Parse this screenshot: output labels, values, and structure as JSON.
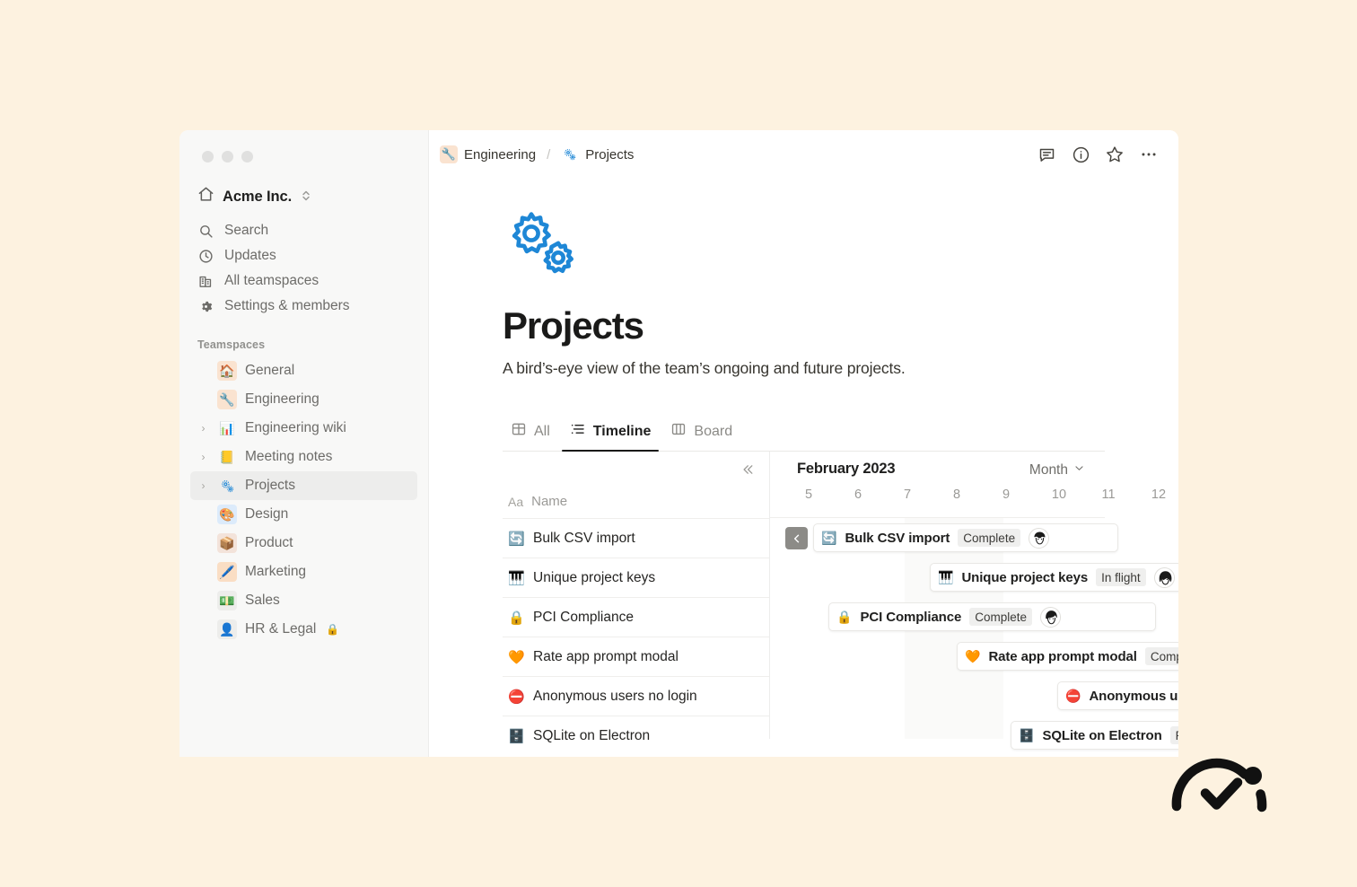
{
  "window": {
    "traffic_lights": [
      "close",
      "minimize",
      "zoom"
    ]
  },
  "sidebar": {
    "workspace": {
      "name": "Acme Inc.",
      "icon": "house-icon",
      "caret": "chevron-updown-icon"
    },
    "nav": [
      {
        "label": "Search",
        "icon": "search-icon"
      },
      {
        "label": "Updates",
        "icon": "clock-icon"
      },
      {
        "label": "All teamspaces",
        "icon": "buildings-icon"
      },
      {
        "label": "Settings & members",
        "icon": "gear-icon"
      }
    ],
    "section_label": "Teamspaces",
    "teamspaces": [
      {
        "label": "General",
        "emoji": "🏠",
        "bg": "#FAE3D0",
        "arrow": false,
        "active": false,
        "locked": false
      },
      {
        "label": "Engineering",
        "emoji": "🔧",
        "bg": "#FAE3D0",
        "arrow": false,
        "active": false,
        "locked": false
      },
      {
        "label": "Engineering wiki",
        "emoji": "📊",
        "bg": "transparent",
        "arrow": true,
        "active": false,
        "locked": false
      },
      {
        "label": "Meeting notes",
        "emoji": "📒",
        "bg": "transparent",
        "arrow": true,
        "active": false,
        "locked": false
      },
      {
        "label": "Projects",
        "emoji": "⚙️",
        "bg": "transparent",
        "arrow": true,
        "active": true,
        "locked": false
      },
      {
        "label": "Design",
        "emoji": "🎨",
        "bg": "#DCEBFB",
        "arrow": false,
        "active": false,
        "locked": false
      },
      {
        "label": "Product",
        "emoji": "📦",
        "bg": "#F3E3DA",
        "arrow": false,
        "active": false,
        "locked": false
      },
      {
        "label": "Marketing",
        "emoji": "🖊️",
        "bg": "#FADEC4",
        "arrow": false,
        "active": false,
        "locked": false
      },
      {
        "label": "Sales",
        "emoji": "💵",
        "bg": "#EDEDEB",
        "arrow": false,
        "active": false,
        "locked": false
      },
      {
        "label": "HR & Legal",
        "emoji": "👤",
        "bg": "#EDEDEB",
        "arrow": false,
        "active": false,
        "locked": true,
        "lock_emoji": "🔒"
      }
    ]
  },
  "topbar": {
    "breadcrumb": [
      {
        "label": "Engineering",
        "emoji": "🔧",
        "bg": "#FAE3D0"
      },
      {
        "label": "Projects",
        "emoji": "⚙️",
        "bg": "transparent"
      }
    ],
    "separator": "/",
    "actions": [
      {
        "name": "comments-icon"
      },
      {
        "name": "info-icon"
      },
      {
        "name": "star-icon"
      },
      {
        "name": "more-options-icon"
      }
    ]
  },
  "page": {
    "icon": "gears-icon",
    "title": "Projects",
    "description": "A bird’s-eye view of the team’s ongoing and future projects."
  },
  "view_tabs": [
    {
      "label": "All",
      "icon": "table-icon",
      "active": false
    },
    {
      "label": "Timeline",
      "icon": "timeline-icon",
      "active": true
    },
    {
      "label": "Board",
      "icon": "board-icon",
      "active": false
    }
  ],
  "timeline": {
    "collapse_icon": "chevrons-left-icon",
    "name_column": {
      "type_glyph": "Aa",
      "header": "Name"
    },
    "month_label": "February 2023",
    "scale": {
      "value": "Month",
      "caret": "chevron-down-icon"
    },
    "day_ticks": [
      "5",
      "6",
      "7",
      "8",
      "9",
      "10",
      "11",
      "12"
    ],
    "rows": [
      {
        "name": "Bulk CSV import",
        "emoji": "🔄"
      },
      {
        "name": "Unique project keys",
        "emoji": "🎹"
      },
      {
        "name": "PCI Compliance",
        "emoji": "🔒"
      },
      {
        "name": "Rate app prompt modal",
        "emoji": "🧡"
      },
      {
        "name": "Anonymous users no login",
        "emoji": "⛔"
      },
      {
        "name": "SQLite on Electron",
        "emoji": "🗄️"
      }
    ],
    "bars": [
      {
        "name": "Bulk CSV import",
        "emoji": "🔄",
        "status": "Complete",
        "has_back_arrow": true,
        "has_avatar": true
      },
      {
        "name": "Unique project keys",
        "emoji": "🎹",
        "status": "In flight",
        "has_back_arrow": false,
        "has_avatar": true
      },
      {
        "name": "PCI Compliance",
        "emoji": "🔒",
        "status": "Complete",
        "has_back_arrow": false,
        "has_avatar": true
      },
      {
        "name": "Rate app prompt modal",
        "emoji": "🧡",
        "status": "Complete",
        "has_back_arrow": false,
        "has_avatar": false
      },
      {
        "name": "Anonymous users no login",
        "emoji": "⛔",
        "status": "",
        "has_back_arrow": false,
        "has_avatar": false
      },
      {
        "name": "SQLite on Electron",
        "emoji": "🗄️",
        "status": "Planned",
        "has_back_arrow": false,
        "has_avatar": false
      }
    ]
  },
  "colors": {
    "page_background": "#FDF2E0",
    "window_background": "#FFFFFF",
    "sidebar_background": "#F8F8F7",
    "accent_blue": "#1E87D6",
    "text_primary": "#37352F",
    "text_muted": "#9B9A97"
  },
  "logo": {
    "name": "checkmark-arc-logo"
  }
}
